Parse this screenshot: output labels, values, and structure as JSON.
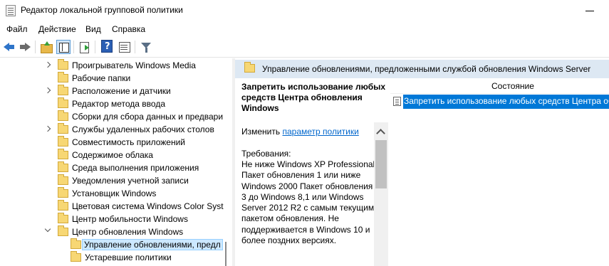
{
  "window": {
    "title": "Редактор локальной групповой политики"
  },
  "menu": [
    "Файл",
    "Действие",
    "Вид",
    "Справка"
  ],
  "toolbar": {
    "icons": [
      "back-arrow-icon",
      "forward-arrow-icon",
      "folder-up-icon",
      "show-hide-tree-icon",
      "export-list-icon",
      "help-icon",
      "properties-icon",
      "filter-icon"
    ]
  },
  "tree": {
    "items": [
      {
        "label": "Проигрыватель Windows Media",
        "expandable": true
      },
      {
        "label": "Рабочие папки",
        "expandable": false
      },
      {
        "label": "Расположение и датчики",
        "expandable": true
      },
      {
        "label": "Редактор метода ввода",
        "expandable": false
      },
      {
        "label": "Сборки для сбора данных и предвари",
        "expandable": false
      },
      {
        "label": "Службы удаленных рабочих столов",
        "expandable": true
      },
      {
        "label": "Совместимость приложений",
        "expandable": false
      },
      {
        "label": "Содержимое облака",
        "expandable": false
      },
      {
        "label": "Среда выполнения приложения",
        "expandable": false
      },
      {
        "label": "Уведомления учетной записи",
        "expandable": false
      },
      {
        "label": "Установщик Windows",
        "expandable": false
      },
      {
        "label": "Цветовая система Windows Color Syst",
        "expandable": false
      },
      {
        "label": "Центр мобильности Windows",
        "expandable": false
      },
      {
        "label": "Центр обновления Windows",
        "expandable": true,
        "expanded": true
      },
      {
        "label": "Управление обновлениями, предл",
        "expandable": false,
        "selected": true,
        "child": true
      },
      {
        "label": "Устаревшие политики",
        "expandable": false,
        "child": true
      }
    ]
  },
  "right": {
    "header": "Управление обновлениями, предложенными службой обновления Windows Server",
    "description": {
      "title": "Запретить использование любых средств Центра обновления Windows",
      "edit_prefix": "Изменить",
      "edit_link": "параметр политики",
      "requirements_label": "Требования:",
      "requirements_text": "Не ниже Windows XP Professional Пакет обновления 1 или ниже Windows 2000 Пакет обновления 3 до Windows 8,1 или Windows Server 2012 R2 с самым текущим пакетом обновления. Не поддерживается в Windows 10 и более поздних версиях."
    },
    "column_status": "Состояние",
    "rows": [
      {
        "text": "Запретить использование любых средств Центра обновления Windows",
        "selected": true
      }
    ]
  },
  "colors": {
    "selection": "#0078d7",
    "header_bg": "#dde8f3",
    "link": "#0066cc"
  }
}
